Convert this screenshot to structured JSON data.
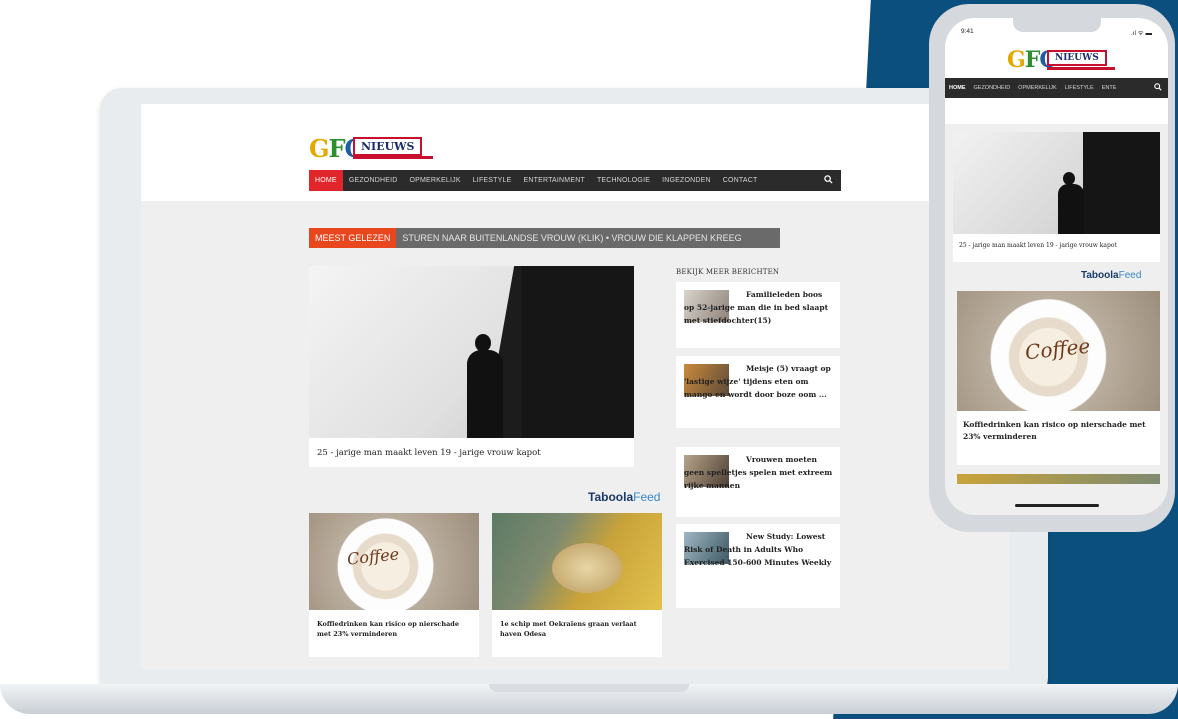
{
  "site": {
    "logo_letters": "GFC",
    "logo_word": "NIEUWS"
  },
  "nav": {
    "items": [
      "HOME",
      "GEZONDHEID",
      "OPMERKELIJK",
      "LIFESTYLE",
      "ENTERTAINMENT",
      "TECHNOLOGIE",
      "INGEZONDEN",
      "CONTACT"
    ],
    "search_icon": "search-icon"
  },
  "ticker": {
    "label": "MEEST GELEZEN",
    "text": "STUREN NAAR BUITENLANDSE VROUW (KLIK)   •  VROUW DIE KLAPPEN KREEG"
  },
  "hero": {
    "caption": "25 - jarige man maakt leven 19 - jarige vrouw kapot"
  },
  "taboola": {
    "brand": "Taboola",
    "suffix": "Feed"
  },
  "cards": [
    {
      "title": "Koffiedrinken kan risico op nierschade met 23% verminderen",
      "image_word": "Coffee"
    },
    {
      "title": "1e schip met Oekraïens graan verlaat haven Odesa"
    }
  ],
  "sidebar": {
    "heading": "BEKIJK MEER BERICHTEN",
    "items": [
      {
        "title": "Familieleden boos op 52-jarige man die in bed slaapt met stiefdochter(15)"
      },
      {
        "title": "Meisje (5) vraagt op 'lastige wijze' tijdens eten om mango en wordt door boze oom ..."
      },
      {
        "title": "Vrouwen moeten geen spelletjes spelen met extreem rijke mannen"
      },
      {
        "title": "New Study: Lowest Risk of Death in Adults Who Exercised 150-600 Minutes Weekly"
      }
    ]
  },
  "phone": {
    "time": "9:41",
    "status_icons": ".ıl ᯤ ▬",
    "nav_items": [
      "HOME",
      "GEZONDHEID",
      "OPMERKELIJK",
      "LIFESTYLE",
      "ENTE"
    ],
    "hero_caption": "25 - jarige man maakt leven 19 - jarige vrouw kapot",
    "card_title": "Koffiedrinken kan risico op nierschade met 23% verminderen",
    "card_image_word": "Coffee"
  },
  "colors": {
    "brand_blue": "#0b4f7e",
    "nav_bg": "#2b2b2b",
    "nav_active": "#e0262a",
    "ticker_label": "#e8471d"
  }
}
